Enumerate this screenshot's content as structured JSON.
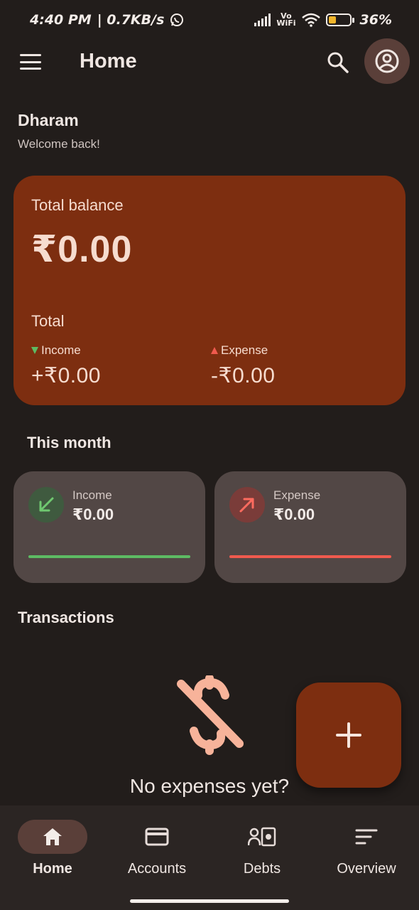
{
  "status_bar": {
    "time": "4:40 PM",
    "speed": "| 0.7KB/s",
    "network_top": "Vo",
    "network_bottom": "WiFi",
    "battery_text": "36%",
    "battery_level": 0.36,
    "battery_color": "#f2b62c"
  },
  "app_bar": {
    "title": "Home",
    "menu_icon": "menu-icon",
    "search_icon": "search-icon",
    "account_icon": "account-circle-icon"
  },
  "greeting": {
    "name": "Dharam",
    "subtitle": "Welcome back!"
  },
  "balance_card": {
    "label": "Total balance",
    "amount": "₹0.00",
    "total_label": "Total",
    "income_label": "Income",
    "income_value": "+₹0.00",
    "expense_label": "Expense",
    "expense_value": "-₹0.00",
    "background": "#7d2e10"
  },
  "this_month": {
    "title": "This month",
    "income": {
      "label": "Income",
      "value": "₹0.00",
      "color": "#5dbb63",
      "icon": "arrow-down-left-icon"
    },
    "expense": {
      "label": "Expense",
      "value": "₹0.00",
      "color": "#ef5a4e",
      "icon": "arrow-up-right-icon"
    }
  },
  "transactions": {
    "title": "Transactions",
    "empty_icon": "money-off-icon",
    "empty_text": "No expenses yet?"
  },
  "fab": {
    "icon": "add-icon"
  },
  "bottom_nav": {
    "items": [
      {
        "label": "Home",
        "icon": "home-icon",
        "active": true
      },
      {
        "label": "Accounts",
        "icon": "credit-card-icon",
        "active": false
      },
      {
        "label": "Debts",
        "icon": "debts-icon",
        "active": false
      },
      {
        "label": "Overview",
        "icon": "sort-icon",
        "active": false
      }
    ]
  }
}
